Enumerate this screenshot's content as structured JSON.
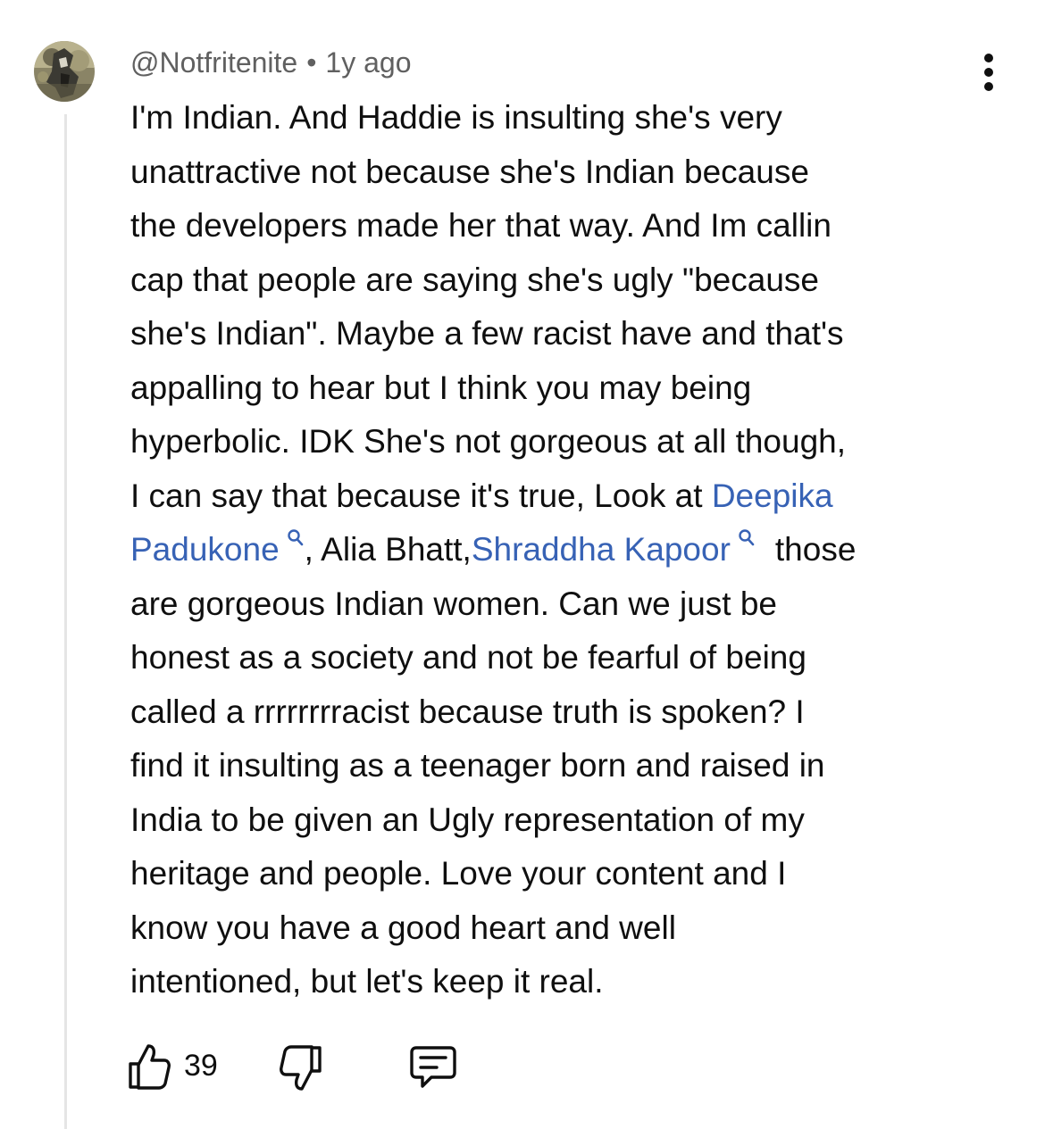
{
  "comment": {
    "author": "@Notfritenite",
    "separator": "•",
    "time": "1y ago",
    "body": {
      "l1": "I'm Indian. And Haddie is insulting she's very",
      "l2": "unattractive not because she's Indian because",
      "l3": "the developers made her that way. And Im callin",
      "l4": "cap that people are saying she's ugly \"because",
      "l5": "she's Indian\". Maybe a few racist have and that's",
      "l6": "appalling to hear but I think you may being",
      "l7": "hyperbolic. IDK She's not gorgeous at all though,",
      "l8_prefix": "I can say that because it's true, Look at ",
      "link1_part1": "Deepika",
      "link1_part2": "Padukone",
      "l9_middle": ", Alia Bhatt,",
      "link2": "Shraddha Kapoor",
      "l9_suffix": "those",
      "l10": "are gorgeous Indian women. Can we just be",
      "l11": "honest as a society and not be fearful of being",
      "l12": "called a rrrrrrrracist because truth is spoken? I",
      "l13": "find it insulting as a teenager born and raised in",
      "l14": "India to be given an Ugly representation of my",
      "l15": "heritage and people. Love your content and I",
      "l16": "know you have a good heart and well",
      "l17": "intentioned, but let's keep it real."
    },
    "like_count": "39"
  },
  "icons": {
    "avatar": "avatar-image",
    "more": "more-vertical-icon",
    "link_search": "search-icon",
    "like": "thumbs-up-icon",
    "dislike": "thumbs-down-icon",
    "reply": "reply-icon"
  },
  "colors": {
    "text": "#0f0f0f",
    "meta": "#606060",
    "link": "#3762b5",
    "thread_line": "#e5e5e5"
  }
}
